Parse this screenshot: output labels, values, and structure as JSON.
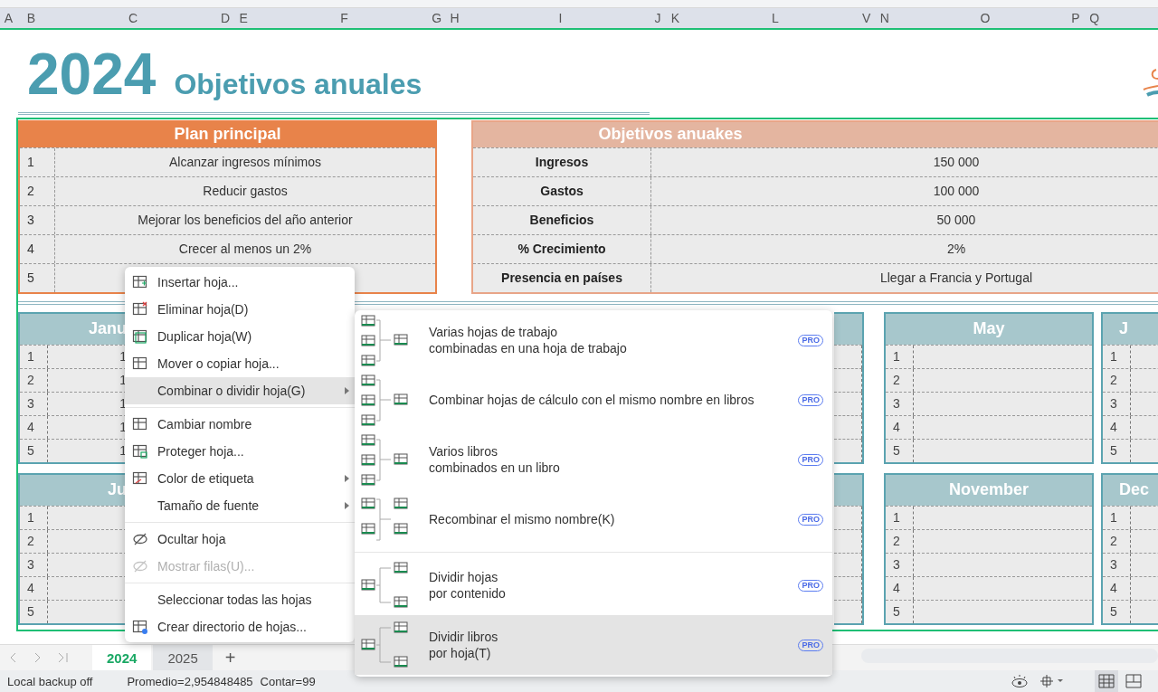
{
  "column_headers": [
    "A",
    "B",
    "C",
    "D",
    "E",
    "F",
    "G",
    "H",
    "I",
    "J",
    "K",
    "L",
    "V",
    "N",
    "O",
    "P",
    "Q"
  ],
  "title": {
    "year": "2024",
    "text": "Objetivos anuales"
  },
  "plan": {
    "title": "Plan principal",
    "rows": [
      {
        "number": "1",
        "text": "Alcanzar ingresos mínimos"
      },
      {
        "number": "2",
        "text": "Reducir gastos"
      },
      {
        "number": "3",
        "text": "Mejorar los beneficios del año anterior"
      },
      {
        "number": "4",
        "text": "Crecer al menos un 2%"
      },
      {
        "number": "5"
      }
    ]
  },
  "objectives": {
    "title": "Objetivos anuakes",
    "rows": [
      {
        "label": "Ingresos",
        "value": "150 000"
      },
      {
        "label": "Gastos",
        "value": "100 000"
      },
      {
        "label": "Beneficios",
        "value": "50 000"
      },
      {
        "label": "% Crecimiento",
        "value": "2%"
      },
      {
        "label": "Presencia en países",
        "value": "Llegar a Francia y Portugal"
      }
    ]
  },
  "calendar_rows": [
    {
      "left": {
        "title": "Janu",
        "rows": [
          {
            "number": "1",
            "value": "1"
          },
          {
            "number": "2",
            "value": "1"
          },
          {
            "number": "3",
            "value": "1"
          },
          {
            "number": "4",
            "value": "1"
          },
          {
            "number": "5",
            "value": "1"
          }
        ]
      },
      "middle": {
        "title": "May",
        "rows": [
          {
            "number": "1"
          },
          {
            "number": "2"
          },
          {
            "number": "3"
          },
          {
            "number": "4"
          },
          {
            "number": "5"
          }
        ]
      },
      "right": {
        "title": "J",
        "rows": [
          {
            "number": "1"
          },
          {
            "number": "2"
          },
          {
            "number": "3"
          },
          {
            "number": "4"
          },
          {
            "number": "5"
          }
        ]
      }
    },
    {
      "left": {
        "title": "Ju",
        "rows": [
          {
            "number": "1"
          },
          {
            "number": "2"
          },
          {
            "number": "3"
          },
          {
            "number": "4"
          },
          {
            "number": "5"
          }
        ]
      },
      "middle": {
        "title": "November",
        "rows": [
          {
            "number": "1"
          },
          {
            "number": "2"
          },
          {
            "number": "3"
          },
          {
            "number": "4"
          },
          {
            "number": "5"
          }
        ]
      },
      "right": {
        "title": "Dec",
        "rows": [
          {
            "number": "1"
          },
          {
            "number": "2"
          },
          {
            "number": "3"
          },
          {
            "number": "4"
          },
          {
            "number": "5"
          }
        ]
      }
    }
  ],
  "context_menu": [
    {
      "kind": "item",
      "label": "Insertar hoja...",
      "selected": false,
      "disabled": false,
      "submenu": false
    },
    {
      "kind": "item",
      "label": "Eliminar hoja(D)",
      "selected": false,
      "disabled": false,
      "submenu": false
    },
    {
      "kind": "item",
      "label": "Duplicar hoja(W)",
      "selected": false,
      "disabled": false,
      "submenu": false
    },
    {
      "kind": "item",
      "label": "Mover o copiar hoja...",
      "selected": false,
      "disabled": false,
      "submenu": false
    },
    {
      "kind": "item",
      "label": "Combinar o dividir hoja(G)",
      "selected": true,
      "disabled": false,
      "submenu": true
    },
    {
      "kind": "separator"
    },
    {
      "kind": "item",
      "label": "Cambiar nombre",
      "selected": false,
      "disabled": false,
      "submenu": false
    },
    {
      "kind": "item",
      "label": "Proteger hoja...",
      "selected": false,
      "disabled": false,
      "submenu": false
    },
    {
      "kind": "item",
      "label": "Color de etiqueta",
      "selected": false,
      "disabled": false,
      "submenu": true
    },
    {
      "kind": "item",
      "label": "Tamaño de fuente",
      "selected": false,
      "disabled": false,
      "submenu": true
    },
    {
      "kind": "separator"
    },
    {
      "kind": "item",
      "label": "Ocultar hoja",
      "selected": false,
      "disabled": false,
      "submenu": false
    },
    {
      "kind": "item",
      "label": "Mostrar filas(U)...",
      "selected": false,
      "disabled": true,
      "submenu": false
    },
    {
      "kind": "separator"
    },
    {
      "kind": "item",
      "label": "Seleccionar todas las hojas",
      "selected": false,
      "disabled": false,
      "submenu": false
    },
    {
      "kind": "item",
      "label": "Crear directorio de hojas...",
      "selected": false,
      "disabled": false,
      "submenu": false
    }
  ],
  "submenu": [
    {
      "kind": "item",
      "lines": [
        "Varias hojas de trabajo",
        "combinadas en una hoja de trabajo"
      ],
      "badge": "PRO",
      "selected": false
    },
    {
      "kind": "item",
      "lines": [
        "Combinar hojas de cálculo con el mismo nombre en libros"
      ],
      "badge": "PRO",
      "selected": false
    },
    {
      "kind": "item",
      "lines": [
        "Varios libros",
        "combinados en un libro"
      ],
      "badge": "PRO",
      "selected": false
    },
    {
      "kind": "item",
      "lines": [
        "Recombinar el mismo nombre(K)"
      ],
      "badge": "PRO",
      "selected": false
    },
    {
      "kind": "separator"
    },
    {
      "kind": "item",
      "lines": [
        "Dividir hojas",
        "por contenido"
      ],
      "badge": "PRO",
      "selected": false
    },
    {
      "kind": "item",
      "lines": [
        "Dividir libros",
        "por hoja(T)"
      ],
      "badge": "PRO",
      "selected": true
    }
  ],
  "sheet_tabs": [
    {
      "label": "2024",
      "selected": true
    },
    {
      "label": "2025",
      "selected": false
    }
  ],
  "add_sheet": "+",
  "status_bar": {
    "backup": "Local backup off",
    "average": "Promedio=2,954848485",
    "count": "Contar=99"
  }
}
